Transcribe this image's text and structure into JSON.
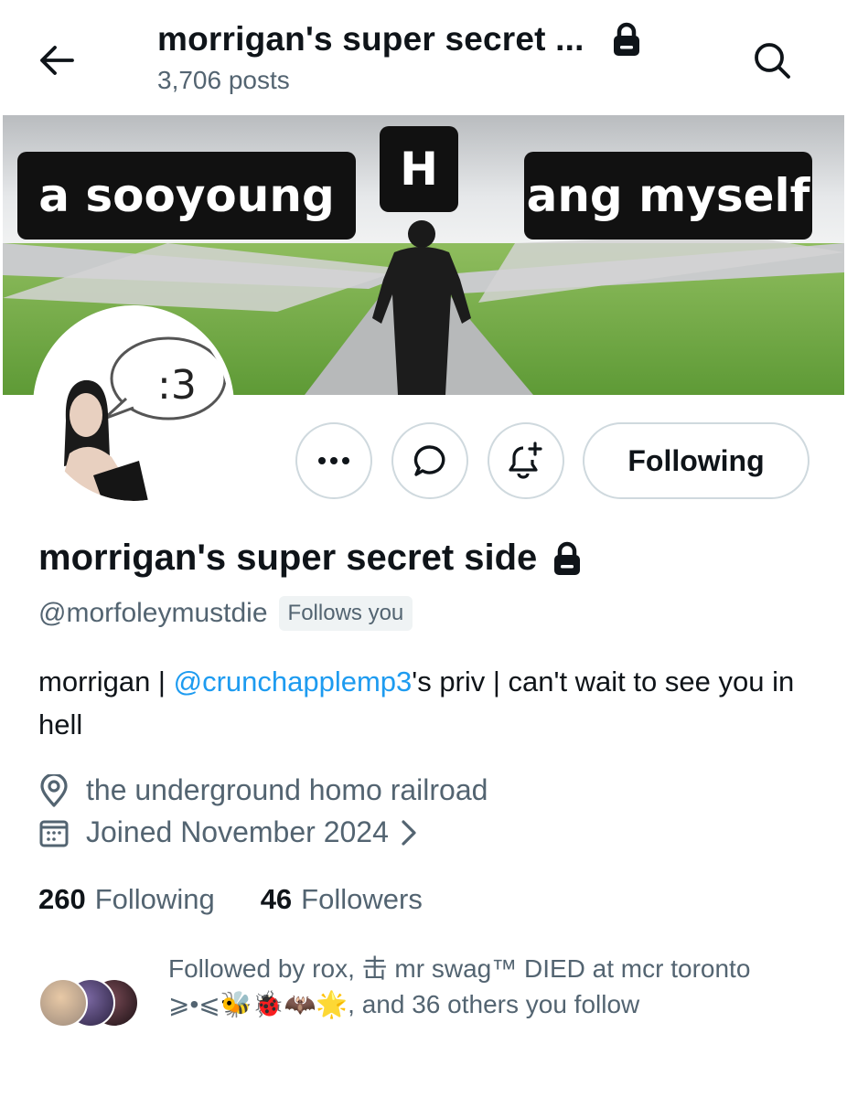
{
  "header": {
    "title": "morrigan's super secret ...",
    "posts": "3,706 posts"
  },
  "banner": {
    "label_left": "a sooyoung",
    "label_mid": "H",
    "label_right": "ang myself"
  },
  "avatar": {
    "speech_text": ":3"
  },
  "actions": {
    "follow_label": "Following"
  },
  "profile": {
    "display_name": "morrigan's super secret side",
    "handle": "@morfoleymustdie",
    "follows_you": "Follows you",
    "bio_prefix": "morrigan | ",
    "bio_mention": "@crunchapplemp3",
    "bio_suffix": "'s priv | can't wait to see you in hell",
    "location": "the underground homo railroad",
    "joined": "Joined November 2024",
    "following_count": "260",
    "following_label": "Following",
    "followers_count": "46",
    "followers_label": "Followers",
    "followed_by": "Followed by rox, 击 mr swag™ DIED at mcr toronto ⩾•⩽🐝🐞🦇🌟, and 36 others you follow"
  },
  "colors": {
    "accent": "#1d9bf0",
    "secondary_text": "#536471",
    "border": "#cfd9de"
  }
}
